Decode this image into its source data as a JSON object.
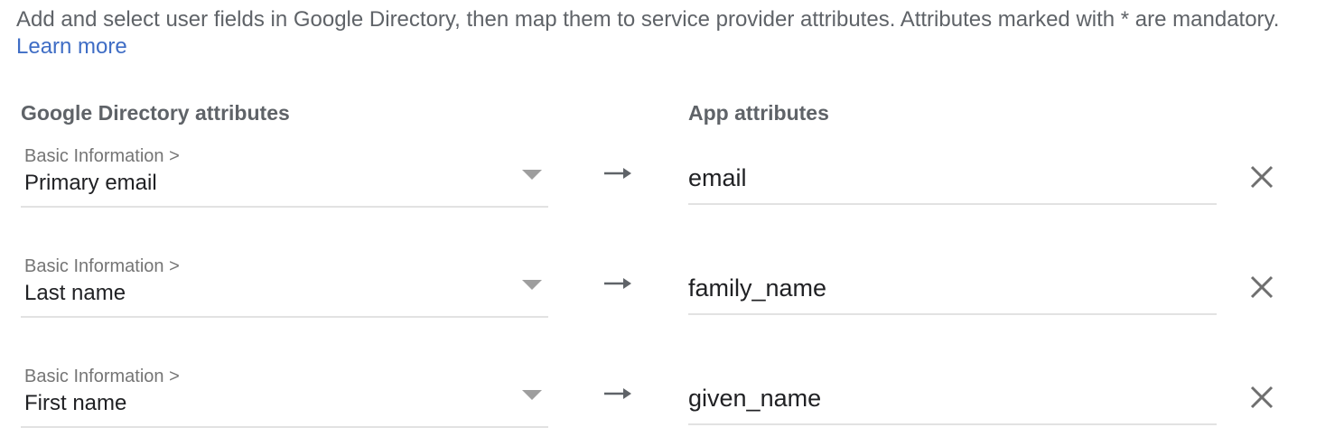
{
  "intro": {
    "text": "Add and select user fields in Google Directory, then map them to service provider attributes. Attributes marked with * are mandatory.",
    "learn_more": "Learn more"
  },
  "columns": {
    "left_header": "Google Directory attributes",
    "right_header": "App attributes"
  },
  "mappings": [
    {
      "category": "Basic Information >",
      "directory_attribute": "Primary email",
      "app_attribute": "email"
    },
    {
      "category": "Basic Information >",
      "directory_attribute": "Last name",
      "app_attribute": "family_name"
    },
    {
      "category": "Basic Information >",
      "directory_attribute": "First name",
      "app_attribute": "given_name"
    }
  ],
  "icons": {
    "arrow": "arrow-right-icon",
    "remove": "close-icon",
    "dropdown": "dropdown-caret-icon"
  },
  "colors": {
    "link": "#3f6dc5",
    "text_secondary": "#5f6368",
    "text_primary": "#202124",
    "underline": "#e2e2e2"
  }
}
